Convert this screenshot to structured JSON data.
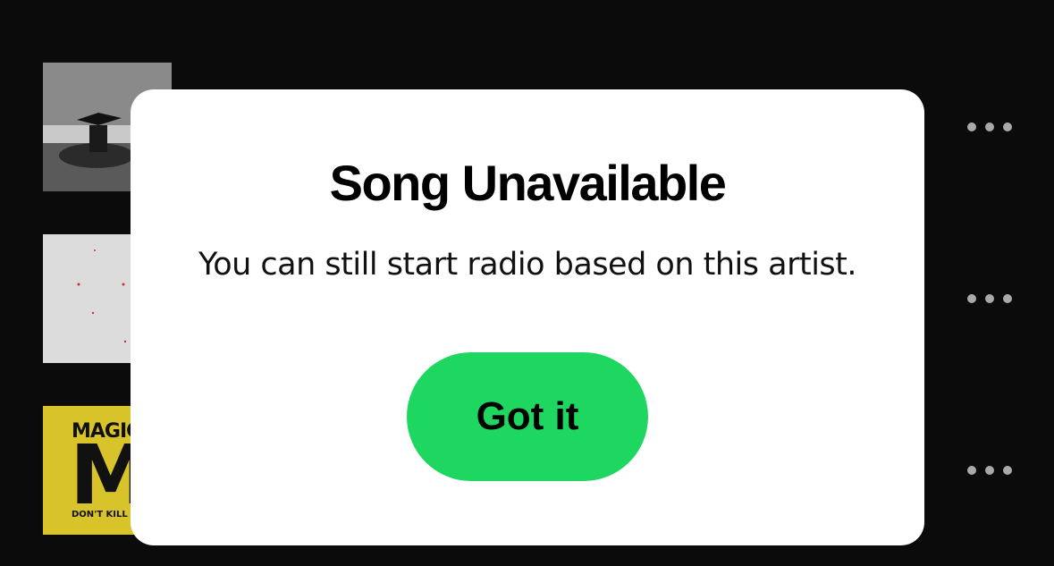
{
  "tracks": [
    {
      "title": "",
      "more_icon": "ellipsis-icon"
    },
    {
      "title": "",
      "more_icon": "ellipsis-icon"
    },
    {
      "title": "",
      "art_text_top": "MAGIC",
      "art_text_big": "M",
      "art_text_bottom": "DON'T KILL THE MA",
      "more_icon": "ellipsis-icon"
    }
  ],
  "dialog": {
    "title": "Song Unavailable",
    "message": "You can still start radio based on this artist.",
    "button_label": "Got it"
  },
  "colors": {
    "background": "#0b0b0b",
    "dialog_background": "#ffffff",
    "accent": "#1ed760",
    "text": "#000000"
  }
}
